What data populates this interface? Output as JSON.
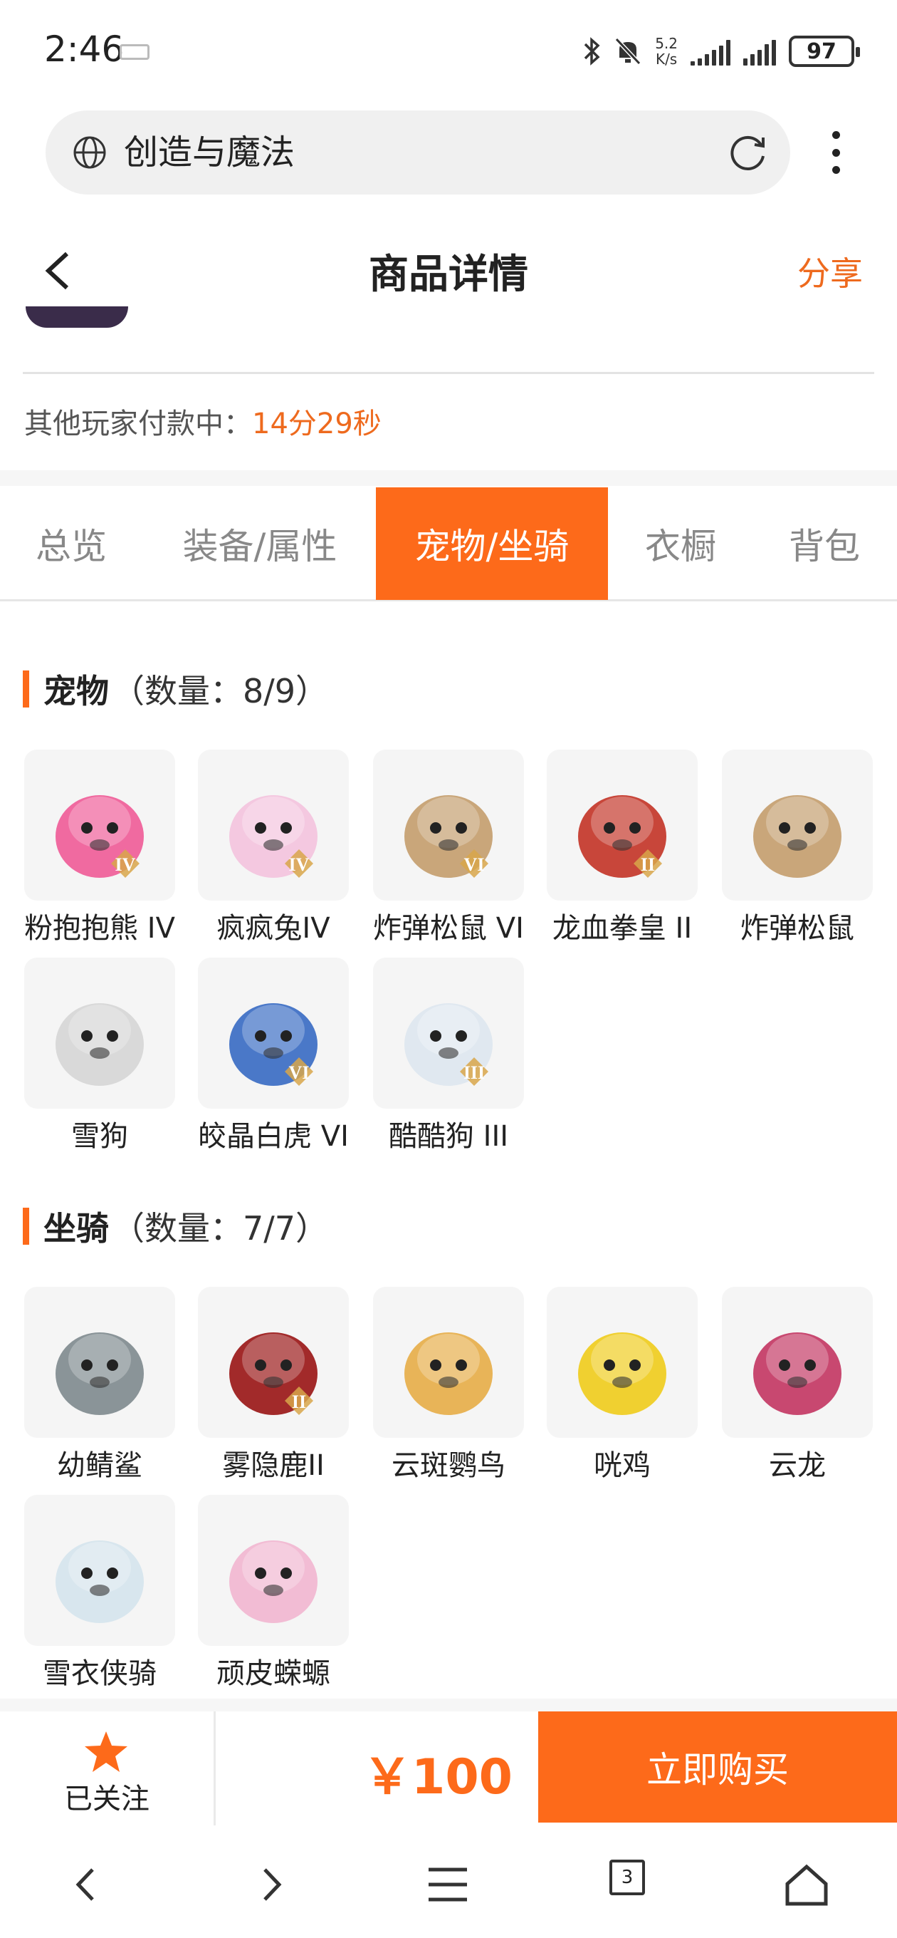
{
  "status_bar": {
    "time": "2:46",
    "net_speed_value": "5.2",
    "net_speed_unit": "K/s",
    "battery": "97"
  },
  "address_bar": {
    "text": "创造与魔法"
  },
  "header": {
    "title": "商品详情",
    "share": "分享"
  },
  "payment": {
    "label": "其他玩家付款中：",
    "countdown": "14分29秒"
  },
  "tabs": [
    {
      "label": "总览",
      "active": false
    },
    {
      "label": "装备/属性",
      "active": false
    },
    {
      "label": "宠物/坐骑",
      "active": true
    },
    {
      "label": "衣橱",
      "active": false
    },
    {
      "label": "背包",
      "active": false
    }
  ],
  "pets": {
    "title": "宠物",
    "count": "（数量：8/9）",
    "items": [
      {
        "name": "粉抱抱熊 IV",
        "color": "#f06aa0",
        "badge": "IV"
      },
      {
        "name": "疯疯兔IV",
        "color": "#f4c8e0",
        "badge": "IV"
      },
      {
        "name": "炸弹松鼠 VI",
        "color": "#c9a67a",
        "badge": "VI"
      },
      {
        "name": "龙血拳皇 II",
        "color": "#c8463a",
        "badge": "II"
      },
      {
        "name": "炸弹松鼠",
        "color": "#c9a67a",
        "badge": ""
      },
      {
        "name": "雪狗",
        "color": "#d9d9d9",
        "badge": ""
      },
      {
        "name": "皎晶白虎 VI",
        "color": "#4a78c8",
        "badge": "VI"
      },
      {
        "name": "酷酷狗 III",
        "color": "#e0e8f0",
        "badge": "III"
      }
    ]
  },
  "mounts": {
    "title": "坐骑",
    "count": "（数量：7/7）",
    "items": [
      {
        "name": "幼鲭鲨",
        "color": "#8a9498",
        "badge": ""
      },
      {
        "name": "雾隐鹿II",
        "color": "#a22a2a",
        "badge": "II"
      },
      {
        "name": "云斑鹦鸟",
        "color": "#e8b458",
        "badge": ""
      },
      {
        "name": "咣鸡",
        "color": "#f0d030",
        "badge": ""
      },
      {
        "name": "云龙",
        "color": "#c84870",
        "badge": ""
      },
      {
        "name": "雪衣侠骑",
        "color": "#d8e6ee",
        "badge": ""
      },
      {
        "name": "顽皮蝾螈",
        "color": "#f2bcd4",
        "badge": ""
      }
    ]
  },
  "bottom_bar": {
    "follow_label": "已关注",
    "price": "￥100",
    "buy_label": "立即购买"
  },
  "system_nav": {
    "tab_count": "3"
  },
  "colors": {
    "accent": "#fd6a1a",
    "accent_text": "#ee6a1e"
  }
}
